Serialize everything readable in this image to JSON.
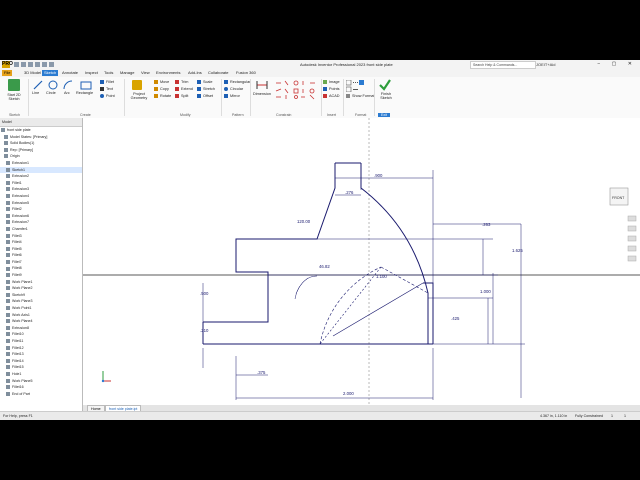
{
  "app": {
    "title": "Autodesk Inventor Professional 2023   front side plate",
    "logo": "PRO",
    "search_placeholder": "Search Help & Commands...",
    "user": "JOEIT+Aid",
    "window_buttons": "− ▢ ✕"
  },
  "tabs": [
    "File",
    "3D Model",
    "Sketch",
    "Annotate",
    "Inspect",
    "Tools",
    "Manage",
    "View",
    "Environments",
    "Add-Ins",
    "Collaborate",
    "Fusion 360"
  ],
  "active_tab": "Sketch",
  "ribbon": {
    "start_sketch": "Start 2D Sketch",
    "sketch_panel": "Sketch",
    "create": {
      "line": "Line",
      "circle": "Circle",
      "arc": "Arc",
      "rectangle": "Rectangle",
      "fillet": "Fillet",
      "text": "Text",
      "point": "Point",
      "panel": "Create"
    },
    "project_geometry": "Project Geometry",
    "modify": {
      "move": "Move",
      "copy": "Copy",
      "rotate": "Rotate",
      "trim": "Trim",
      "extend": "Extend",
      "split": "Split",
      "scale": "Scale",
      "stretch": "Stretch",
      "offset": "Offset",
      "panel": "Modify"
    },
    "pattern": {
      "rectangular": "Rectangular",
      "circular": "Circular",
      "mirror": "Mirror",
      "panel": "Pattern"
    },
    "constrain": {
      "dimension": "Dimension",
      "panel": "Constrain"
    },
    "insert": {
      "image": "Image",
      "points": "Points",
      "acad": "ACAD",
      "panel": "Insert"
    },
    "format": {
      "show_format": "Show Format",
      "panel": "Format"
    },
    "exit": {
      "finish_sketch": "Finish Sketch",
      "panel": "Exit"
    }
  },
  "browser": {
    "header": "Model",
    "items": [
      "front side plate",
      "Model States: [Primary]",
      "Solid Bodies(1)",
      "Rep: [Primary]",
      "Origin",
      "Extrusion1",
      "Sketch1",
      "Extrusion2",
      "Fillet1",
      "Extrusion3",
      "Extrusion4",
      "Extrusion5",
      "Fillet2",
      "Extrusion6",
      "Extrusion7",
      "Chamfer1",
      "Fillet3",
      "Fillet4",
      "Fillet5",
      "Fillet6",
      "Fillet7",
      "Fillet8",
      "Fillet9",
      "Work Plane1",
      "Work Plane2",
      "Sketch9",
      "Work Plane3",
      "Work Point1",
      "Work Axis1",
      "Work Plane4",
      "Extrusion8",
      "Fillet10",
      "Fillet11",
      "Fillet12",
      "Fillet13",
      "Fillet14",
      "Fillet15",
      "Hole1",
      "Work Plane5",
      "Fillet16",
      "End of Part"
    ]
  },
  "canvas": {
    "view_cube": "FRONT",
    "dimensions": {
      "d_900": ".900",
      "d_276": ".276",
      "d_120": "120.00",
      "d_263": ".263",
      "d_1625": "1.625",
      "d_1000": "1.000",
      "d_4682": "46.82",
      "d_1100": "1.100",
      "d_500": ".500",
      "d_425": ".425",
      "d_210": ".210",
      "d_375": ".375",
      "d_2000": "2.000"
    }
  },
  "doc_tabs": [
    "Home",
    "front side plate.ipt"
  ],
  "status": {
    "help": "For Help, press F1",
    "coords": "4.367 in, 1.110 in",
    "constraint": "Fully Constrained",
    "count1": "1",
    "count2": "1"
  }
}
